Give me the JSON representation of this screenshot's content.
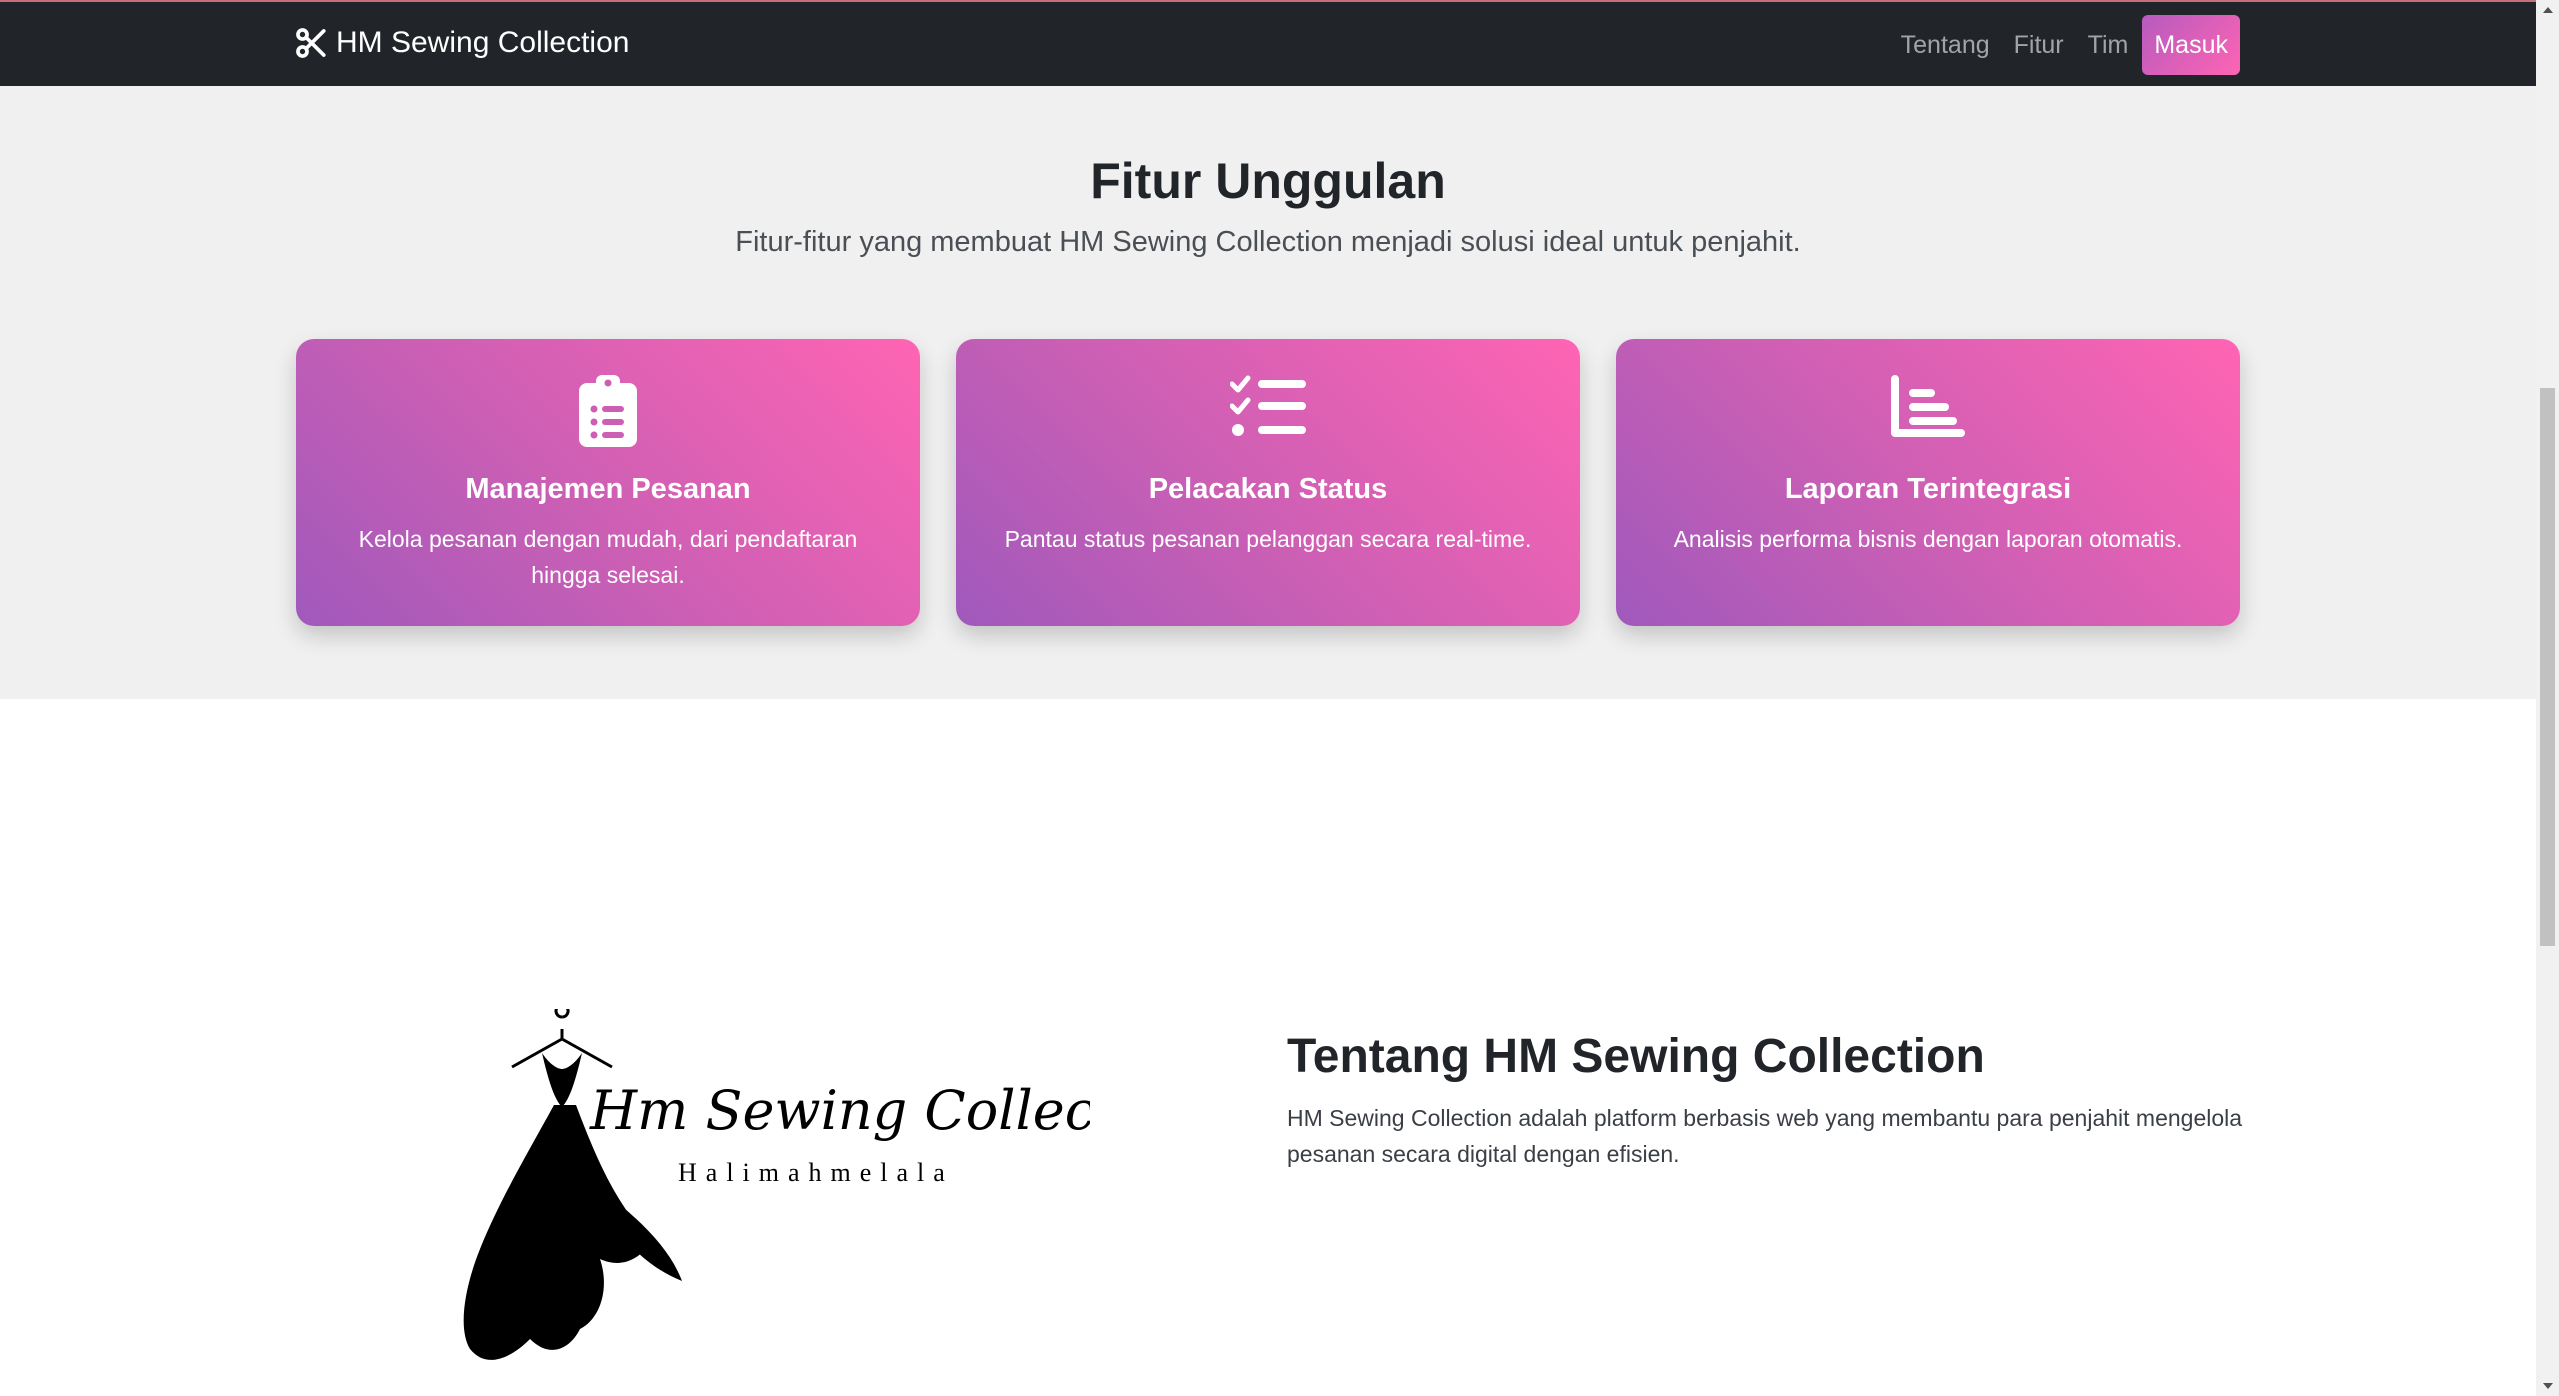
{
  "navbar": {
    "brand": "HM Sewing Collection",
    "links": [
      "Tentang",
      "Fitur",
      "Tim"
    ],
    "login_button": "Masuk"
  },
  "features": {
    "title": "Fitur Unggulan",
    "subtitle": "Fitur-fitur yang membuat HM Sewing Collection menjadi solusi ideal untuk penjahit.",
    "cards": [
      {
        "icon": "clipboard-list-icon",
        "title": "Manajemen Pesanan",
        "text": "Kelola pesanan dengan mudah, dari pendaftaran hingga selesai."
      },
      {
        "icon": "list-check-icon",
        "title": "Pelacakan Status",
        "text": "Pantau status pesanan pelanggan secara real-time."
      },
      {
        "icon": "chart-bar-icon",
        "title": "Laporan Terintegrasi",
        "text": "Analisis performa bisnis dengan laporan otomatis."
      }
    ]
  },
  "about": {
    "logo": {
      "script_text": "Hm Sewing Collection",
      "tagline": "Halimahmelala"
    },
    "title": "Tentang HM Sewing Collection",
    "text": "HM Sewing Collection adalah platform berbasis web yang membantu para penjahit mengelola pesanan secara digital dengan efisien."
  },
  "colors": {
    "navbar_bg": "#212529",
    "gradient_start": "#a059bc",
    "gradient_end": "#ff64b3",
    "features_bg": "#f0f0f0"
  }
}
